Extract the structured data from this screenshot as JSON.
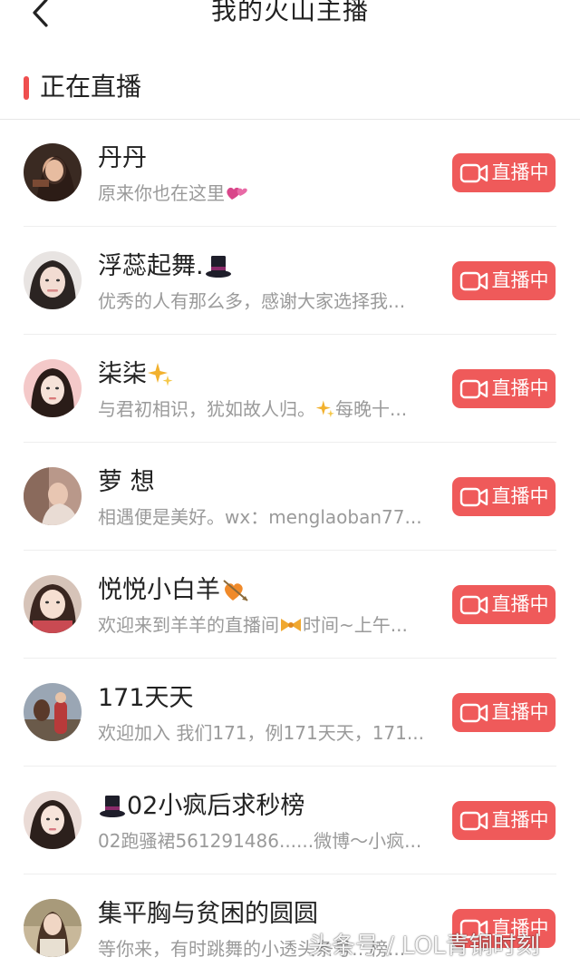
{
  "header": {
    "title": "我的火山主播"
  },
  "section": {
    "title": "正在直播"
  },
  "live_label": "直播中",
  "colors": {
    "accent": "#ef5a5a",
    "section_bar": "#ef4f4f"
  },
  "items": [
    {
      "name": "丹丹",
      "desc": "原来你也在这里",
      "name_emoji": "",
      "desc_emoji": "hearts"
    },
    {
      "name": "浮蕊起舞.",
      "desc": "优秀的人有那么多，感谢大家选择我...",
      "name_emoji": "tophat",
      "desc_emoji": ""
    },
    {
      "name": "柒柒",
      "desc": "与君初相识，犹如故人归。",
      "desc2": "每晚十...",
      "name_emoji": "sparkle",
      "desc_emoji": "sparkle"
    },
    {
      "name": "萝 想",
      "desc": "相遇便是美好。wx：menglaoban77...",
      "name_emoji": "",
      "desc_emoji": ""
    },
    {
      "name": "悦悦小白羊",
      "desc": "欢迎来到羊羊的直播间",
      "desc2": "时间~上午...",
      "name_emoji": "heart-arrow",
      "desc_emoji": "bow"
    },
    {
      "name": "171天天",
      "desc": "欢迎加入 我们171，例171天天，171...",
      "name_emoji": "",
      "desc_emoji": ""
    },
    {
      "name": "02小疯后求秒榜",
      "desc": "02跑骚裙561291486......微博～小疯...",
      "name_emoji": "tophat-lead",
      "desc_emoji": ""
    },
    {
      "name": "集平胸与贫困的圆圆",
      "desc": "等你来，有时跳舞的小透头条号…榜...",
      "name_emoji": "",
      "desc_emoji": ""
    }
  ],
  "watermark": "头条号 / LOL青铜时刻"
}
